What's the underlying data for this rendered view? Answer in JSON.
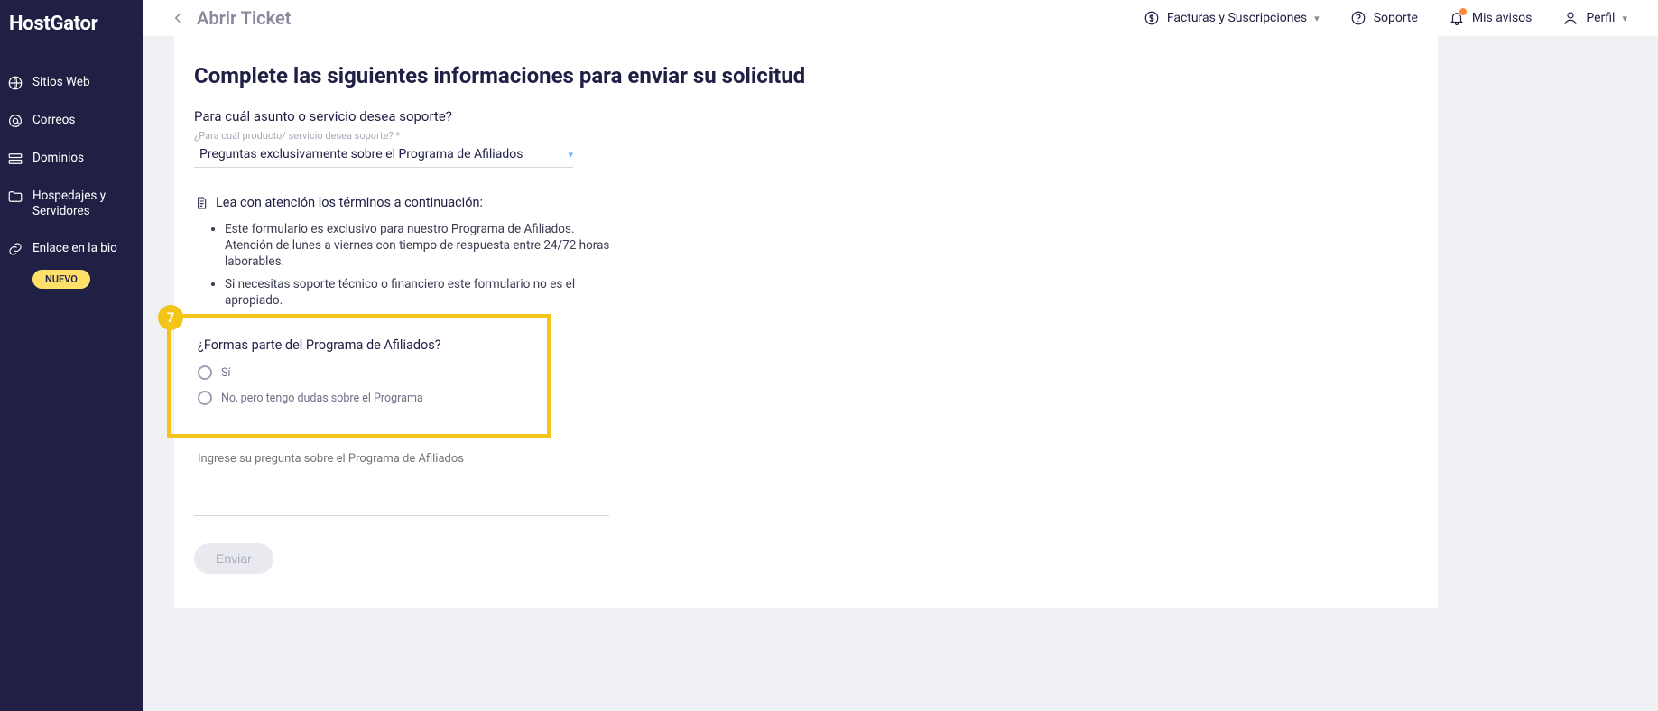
{
  "brand": "HostGator",
  "sidebar": {
    "items": [
      {
        "label": "Sitios Web"
      },
      {
        "label": "Correos"
      },
      {
        "label": "Dominios"
      },
      {
        "label": "Hospedajes y Servidores"
      },
      {
        "label": "Enlace en la bio"
      }
    ],
    "new_badge": "NUEVO"
  },
  "topbar": {
    "page_title": "Abrir Ticket",
    "billing": "Facturas y Suscripciones",
    "support": "Soporte",
    "notices": "Mis avisos",
    "profile": "Perfil"
  },
  "form": {
    "title": "Complete las siguientes informaciones para enviar su solicitud",
    "question1": "Para cuál asunto o servicio desea soporte?",
    "select_label": "¿Para cuál producto/ servicio desea soporte? *",
    "select_value": "Preguntas exclusivamente sobre el Programa de Afiliados",
    "notice": "Lea con atención los términos a continuación:",
    "terms": [
      "Este formulario es exclusivo para nuestro Programa de Afiliados. Atención de lunes a viernes con tiempo de respuesta entre 24/72 horas laborables.",
      "Si necesitas soporte técnico o financiero este formulario no es el apropiado."
    ],
    "highlight_number": "7",
    "question2": "¿Formas parte del Programa de Afiliados?",
    "radio_options": [
      "Sí",
      "No, pero tengo dudas sobre el Programa"
    ],
    "textarea_placeholder": "Ingrese su pregunta sobre el Programa de Afiliados",
    "submit": "Enviar"
  }
}
